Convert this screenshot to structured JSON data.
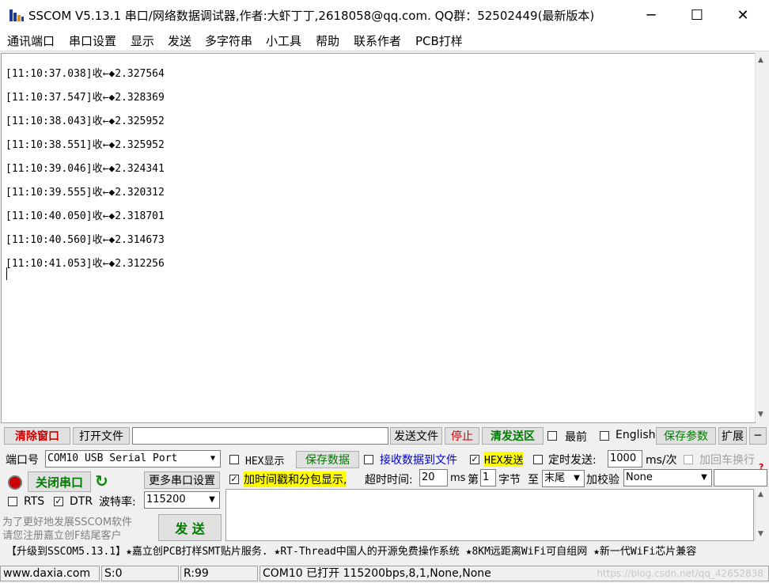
{
  "title": "SSCOM V5.13.1 串口/网络数据调试器,作者:大虾丁丁,2618058@qq.com. QQ群：52502449(最新版本)",
  "window_controls": {
    "minimize": "─",
    "maximize": "☐",
    "close": "✕"
  },
  "menu": [
    "通讯端口",
    "串口设置",
    "显示",
    "发送",
    "多字符串",
    "小工具",
    "帮助",
    "联系作者",
    "PCB打样"
  ],
  "receive_lines": [
    "[11:10:37.038]收←◆2.327564",
    "[11:10:37.547]收←◆2.328369",
    "[11:10:38.043]收←◆2.325952",
    "[11:10:38.551]收←◆2.325952",
    "[11:10:39.046]收←◆2.324341",
    "[11:10:39.555]收←◆2.320312",
    "[11:10:40.050]收←◆2.318701",
    "[11:10:40.560]收←◆2.314673",
    "[11:10:41.053]收←◆2.312256"
  ],
  "toolbar": {
    "clear_window": "清除窗口",
    "open_file": "打开文件",
    "file_path": "",
    "send_file": "发送文件",
    "stop": "停止",
    "clear_send": "清发送区",
    "topmost": "最前",
    "english": "English",
    "save_params": "保存参数",
    "expand": "扩展",
    "collapse": "─"
  },
  "port": {
    "label": "端口号",
    "value": "COM10 USB Serial Port",
    "close_port": "关闭串口",
    "more_settings": "更多串口设置",
    "rts": "RTS",
    "dtr": "DTR",
    "baud_label": "波特率:",
    "baud_value": "115200"
  },
  "options": {
    "hex_display": "HEX显示",
    "save_data": "保存数据",
    "recv_to_file": "接收数据到文件",
    "hex_send": "HEX发送",
    "timed_send": "定时发送:",
    "interval": "1000",
    "interval_unit": "ms/次",
    "add_crlf": "加回车换行",
    "add_timestamp": "加时间戳和分包显示,",
    "timeout_label": "超时时间:",
    "timeout_value": "20",
    "timeout_unit": "ms",
    "byte_prefix": "第",
    "byte_index": "1",
    "byte_label": "字节",
    "to_label": "至",
    "end_value": "末尾",
    "checksum_label": "加校验",
    "checksum_value": "None"
  },
  "promo": {
    "line1": "为了更好地发展SSCOM软件",
    "line2": "请您注册嘉立创F结尾客户",
    "send_button": "发 送"
  },
  "ticker": "【升级到SSCOM5.13.1】★嘉立创PCB打样SMT贴片服务. ★RT-Thread中国人的开源免费操作系统 ★8KM远距离WiFi可自组网 ★新一代WiFi芯片兼容",
  "status": {
    "website": "www.daxia.com",
    "sent": "S:0",
    "received": "R:99",
    "port_info": "COM10 已打开  115200bps,8,1,None,None",
    "watermark": "https://blog.csdn.net/qq_42652838"
  },
  "colors": {
    "stop_red": "#cc0000",
    "clear_red": "#cc0000",
    "green": "#007a00",
    "hex_send_bg": "#ffff00",
    "timestamp_bg": "#ffff00",
    "link_blue": "#0000cc"
  }
}
